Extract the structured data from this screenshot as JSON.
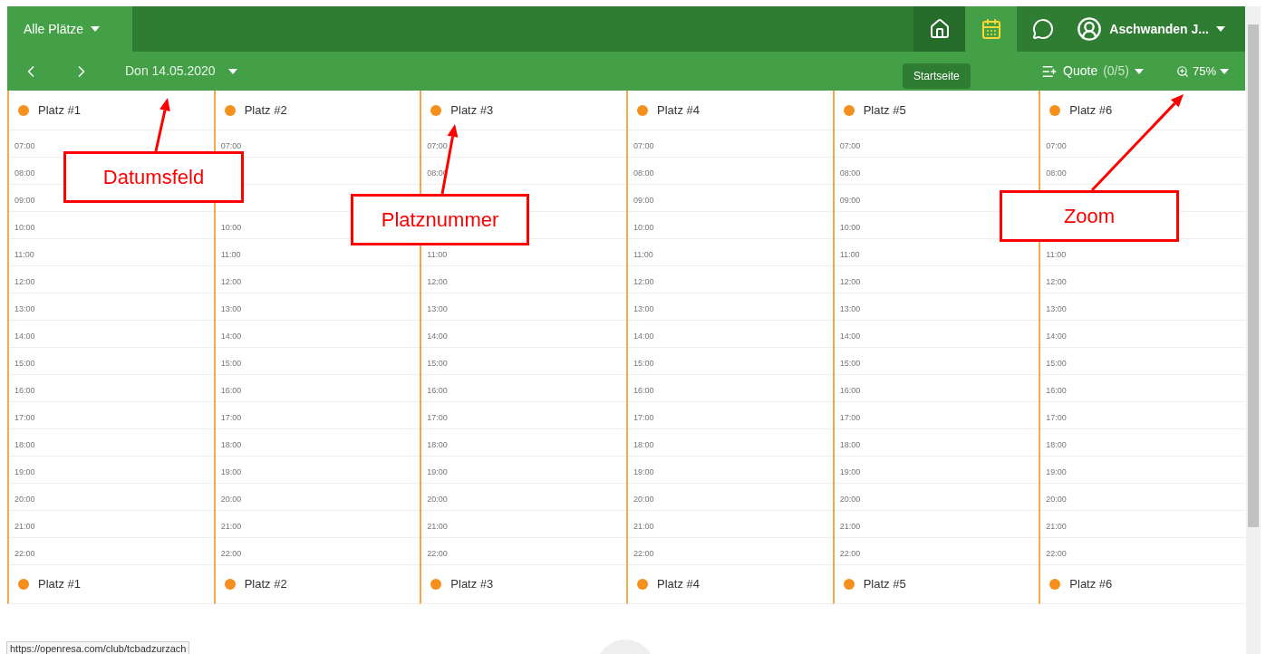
{
  "top_bar": {
    "court_filter": "Alle Plätze",
    "tabs": [
      {
        "kind": "home",
        "selected": false,
        "hovered": true
      },
      {
        "kind": "calendar",
        "selected": true,
        "hovered": false
      },
      {
        "kind": "chat",
        "selected": false,
        "hovered": false
      }
    ],
    "user": "Aschwanden J..."
  },
  "tooltip": "Startseite",
  "date_bar": {
    "date": "Don 14.05.2020",
    "quote_label": "Quote",
    "quote_count": "(0/5)",
    "zoom": "75%"
  },
  "courts": [
    {
      "name": "Platz #1",
      "color": "#f5901e",
      "slots": [
        {
          "kind": "hour",
          "time": "07:00"
        },
        {
          "kind": "hour",
          "time": "08:00"
        },
        {
          "kind": "hour",
          "time": "09:00"
        },
        {
          "kind": "hour",
          "time": "10:00"
        },
        {
          "kind": "hour",
          "time": "11:00"
        },
        {
          "kind": "hour",
          "time": "12:00"
        },
        {
          "kind": "hour",
          "time": "13:00"
        },
        {
          "kind": "hour",
          "time": "14:00"
        },
        {
          "kind": "hour",
          "time": "15:00"
        },
        {
          "kind": "hour",
          "time": "16:00"
        },
        {
          "kind": "hour",
          "time": "17:00"
        },
        {
          "kind": "hour",
          "time": "18:00"
        },
        {
          "kind": "hour",
          "time": "19:00"
        },
        {
          "kind": "hour",
          "time": "20:00"
        },
        {
          "kind": "hour",
          "time": "21:00"
        },
        {
          "kind": "hour",
          "time": "22:00"
        }
      ]
    },
    {
      "name": "Platz #2",
      "color": "#f5901e",
      "slots": [
        {
          "kind": "hour",
          "time": "07:00"
        },
        {
          "kind": "covered"
        },
        {
          "kind": "covered"
        },
        {
          "kind": "hour",
          "time": "10:00"
        },
        {
          "kind": "hour",
          "time": "11:00"
        },
        {
          "kind": "hour",
          "time": "12:00"
        },
        {
          "kind": "hour",
          "time": "13:00"
        },
        {
          "kind": "hour",
          "time": "14:00"
        },
        {
          "kind": "hour",
          "time": "15:00"
        },
        {
          "kind": "hour",
          "time": "16:00"
        },
        {
          "kind": "hour",
          "time": "17:00"
        },
        {
          "kind": "hour",
          "time": "18:00"
        },
        {
          "kind": "hour",
          "time": "19:00"
        },
        {
          "kind": "hour",
          "time": "20:00"
        },
        {
          "kind": "hour",
          "time": "21:00"
        },
        {
          "kind": "hour",
          "time": "22:00"
        }
      ]
    },
    {
      "name": "Platz #3",
      "color": "#f5901e",
      "slots": [
        {
          "kind": "hour",
          "time": "07:00"
        },
        {
          "kind": "hour",
          "time": "08:00"
        },
        {
          "kind": "covered"
        },
        {
          "kind": "covered"
        },
        {
          "kind": "hour",
          "time": "11:00"
        },
        {
          "kind": "hour",
          "time": "12:00"
        },
        {
          "kind": "hour",
          "time": "13:00"
        },
        {
          "kind": "hour",
          "time": "14:00"
        },
        {
          "kind": "hour",
          "time": "15:00"
        },
        {
          "kind": "hour",
          "time": "16:00"
        },
        {
          "kind": "hour",
          "time": "17:00"
        },
        {
          "kind": "hour",
          "time": "18:00"
        },
        {
          "kind": "hour",
          "time": "19:00"
        },
        {
          "kind": "hour",
          "time": "20:00"
        },
        {
          "kind": "hour",
          "time": "21:00"
        },
        {
          "kind": "hour",
          "time": "22:00"
        }
      ]
    },
    {
      "name": "Platz #4",
      "color": "#f5901e",
      "slots": [
        {
          "kind": "hour",
          "time": "07:00"
        },
        {
          "kind": "hour",
          "time": "08:00"
        },
        {
          "kind": "hour",
          "time": "09:00"
        },
        {
          "kind": "hour",
          "time": "10:00"
        },
        {
          "kind": "hour",
          "time": "11:00"
        },
        {
          "kind": "hour",
          "time": "12:00"
        },
        {
          "kind": "hour",
          "time": "13:00"
        },
        {
          "kind": "hour",
          "time": "14:00"
        },
        {
          "kind": "hour",
          "time": "15:00"
        },
        {
          "kind": "hour",
          "time": "16:00"
        },
        {
          "kind": "hour",
          "time": "17:00"
        },
        {
          "kind": "hour",
          "time": "18:00"
        },
        {
          "kind": "hour",
          "time": "19:00"
        },
        {
          "kind": "hour",
          "time": "20:00"
        },
        {
          "kind": "hour",
          "time": "21:00"
        },
        {
          "kind": "hour",
          "time": "22:00"
        }
      ]
    },
    {
      "name": "Platz #5",
      "color": "#f5901e",
      "slots": [
        {
          "kind": "hour",
          "time": "07:00"
        },
        {
          "kind": "hour",
          "time": "08:00"
        },
        {
          "kind": "hour",
          "time": "09:00"
        },
        {
          "kind": "hour",
          "time": "10:00"
        },
        {
          "kind": "hour",
          "time": "11:00"
        },
        {
          "kind": "hour",
          "time": "12:00"
        },
        {
          "kind": "hour",
          "time": "13:00"
        },
        {
          "kind": "hour",
          "time": "14:00"
        },
        {
          "kind": "hour",
          "time": "15:00"
        },
        {
          "kind": "hour",
          "time": "16:00"
        },
        {
          "kind": "hour",
          "time": "17:00"
        },
        {
          "kind": "hour",
          "time": "18:00"
        },
        {
          "kind": "hour",
          "time": "19:00"
        },
        {
          "kind": "hour",
          "time": "20:00"
        },
        {
          "kind": "hour",
          "time": "21:00"
        },
        {
          "kind": "hour",
          "time": "22:00"
        }
      ]
    },
    {
      "name": "Platz #6",
      "color": "#f5901e",
      "slots": [
        {
          "kind": "hour",
          "time": "07:00"
        },
        {
          "kind": "hour",
          "time": "08:00"
        },
        {
          "kind": "covered"
        },
        {
          "kind": "covered"
        },
        {
          "kind": "hour",
          "time": "11:00"
        },
        {
          "kind": "hour",
          "time": "12:00"
        },
        {
          "kind": "hour",
          "time": "13:00"
        },
        {
          "kind": "hour",
          "time": "14:00"
        },
        {
          "kind": "hour",
          "time": "15:00"
        },
        {
          "kind": "hour",
          "time": "16:00"
        },
        {
          "kind": "hour",
          "time": "17:00"
        },
        {
          "kind": "hour",
          "time": "18:00"
        },
        {
          "kind": "hour",
          "time": "19:00"
        },
        {
          "kind": "hour",
          "time": "20:00"
        },
        {
          "kind": "hour",
          "time": "21:00"
        },
        {
          "kind": "hour",
          "time": "22:00"
        }
      ]
    }
  ],
  "footer_courts": [
    {
      "name": "Platz #1",
      "color": "#f5901e"
    },
    {
      "name": "Platz #2",
      "color": "#f5901e"
    },
    {
      "name": "Platz #3",
      "color": "#f5901e"
    },
    {
      "name": "Platz #4",
      "color": "#f5901e"
    },
    {
      "name": "Platz #5",
      "color": "#f5901e"
    },
    {
      "name": "Platz #6",
      "color": "#f5901e"
    }
  ],
  "status_url": "https://openresa.com/club/tcbadzurzach",
  "annotations": [
    {
      "label": "Datumsfeld"
    },
    {
      "label": "Platznummer"
    },
    {
      "label": "Zoom"
    }
  ]
}
